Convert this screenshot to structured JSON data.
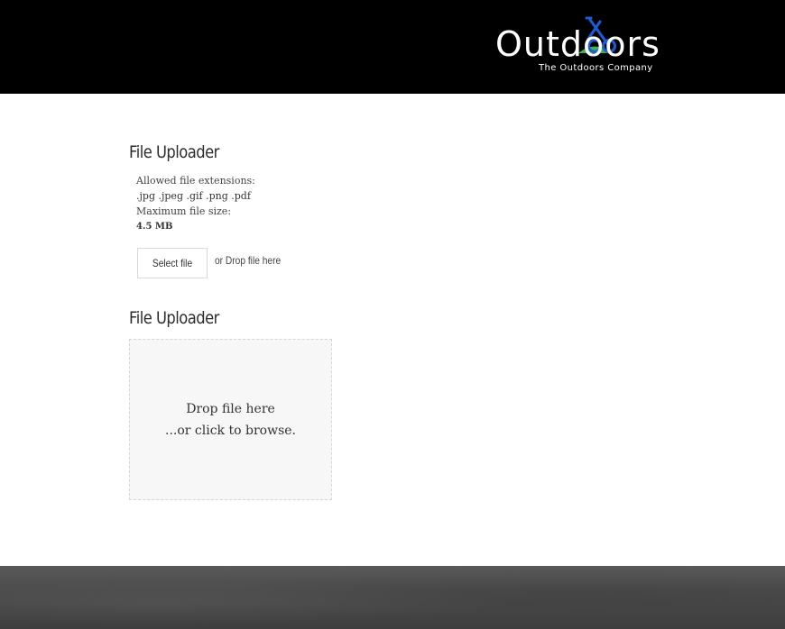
{
  "brand": {
    "logo_text": "Outdoors",
    "tagline": "The Outdoors Company",
    "colors": {
      "bike": "#1e5bd8",
      "hill": "#3bb54a"
    }
  },
  "uploaders": [
    {
      "title": "File Uploader",
      "allowed_label": "Allowed file extensions:",
      "allowed_value": ".jpg .jpeg .gif .png .pdf",
      "max_label": "Maximum file size:",
      "max_value": "4.5 MB",
      "select_button": "Select file",
      "drop_hint": "or Drop file here"
    },
    {
      "title": "File Uploader",
      "dropzone_line1": "Drop file here",
      "dropzone_line2": "...or click to browse."
    }
  ],
  "colors": {
    "header_bg": "#000000",
    "dropzone_bg": "#f7f7f7",
    "footer_bg": "#4b4b4b"
  }
}
